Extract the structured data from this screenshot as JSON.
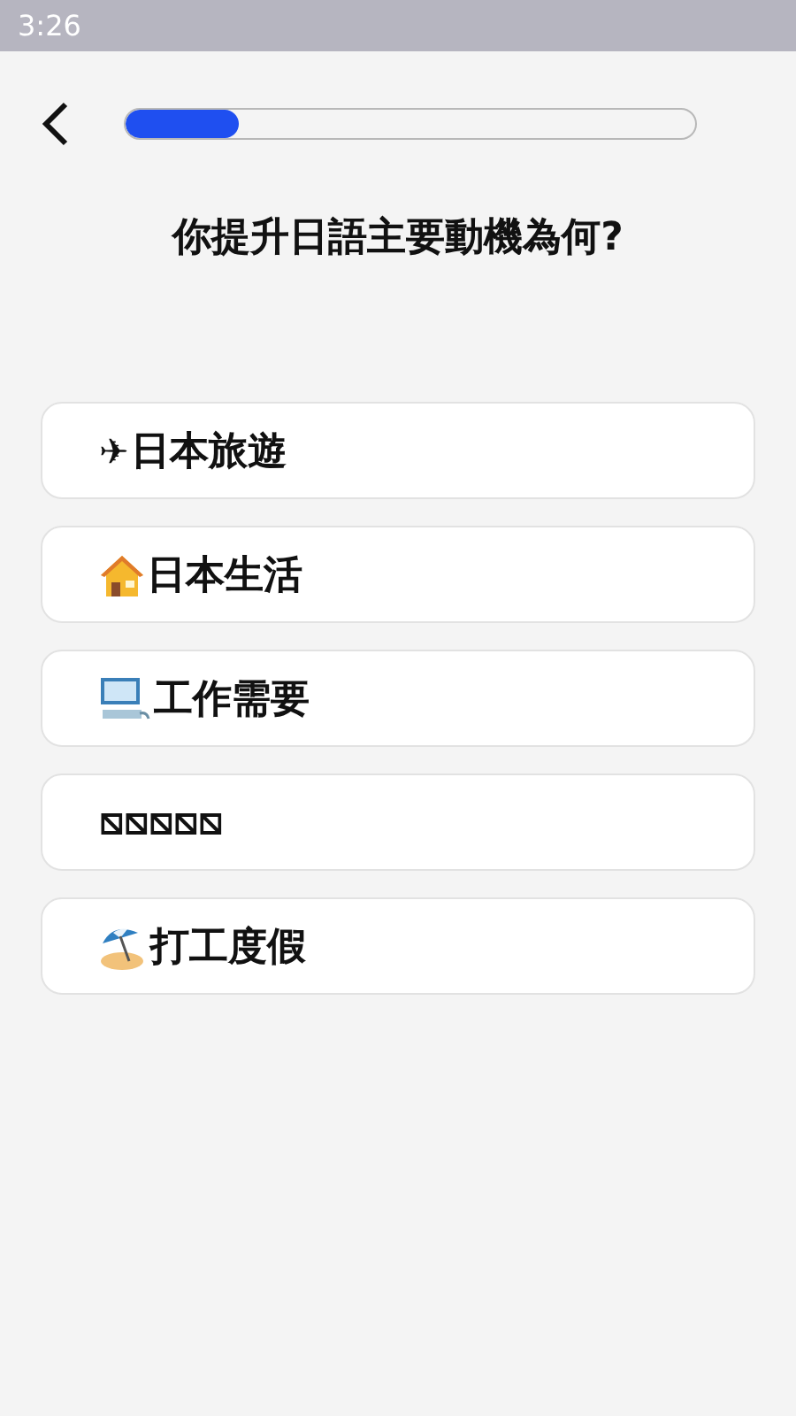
{
  "status_bar": {
    "time": "3:26"
  },
  "progress": {
    "level": 0.2
  },
  "question": "你提升日語主要動機為何?",
  "options": [
    {
      "kind": "glyph",
      "glyph": "✈",
      "label": "日本旅遊"
    },
    {
      "kind": "house",
      "label": "日本生活"
    },
    {
      "kind": "computer",
      "label": "工作需要"
    },
    {
      "kind": "plain",
      "label": "⧅⧅⧅⧅⧅"
    },
    {
      "kind": "beach",
      "label": "打工度假"
    }
  ]
}
